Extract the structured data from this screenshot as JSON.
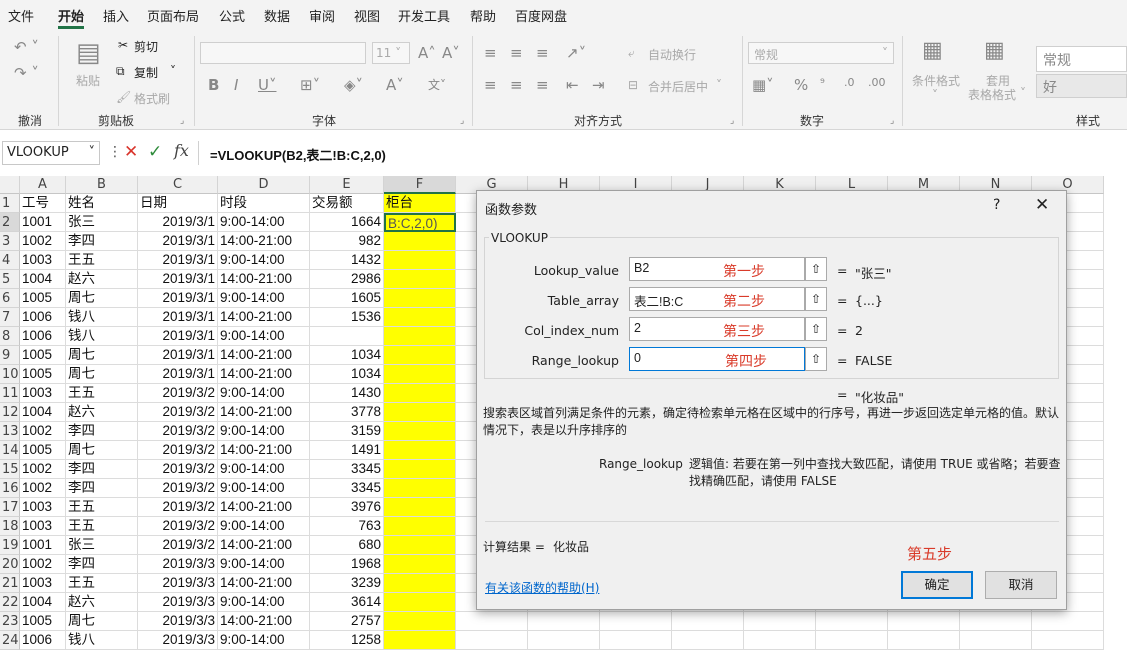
{
  "menu": {
    "tabs": [
      "文件",
      "开始",
      "插入",
      "页面布局",
      "公式",
      "数据",
      "审阅",
      "视图",
      "开发工具",
      "帮助",
      "百度网盘"
    ]
  },
  "ribbon": {
    "undo_group": "撤消",
    "clipboard": {
      "cut": "剪切",
      "copy": "复制",
      "paste": "粘贴",
      "painter": "格式刷",
      "label": "剪贴板"
    },
    "font": {
      "size": "11",
      "label": "字体"
    },
    "alignment": {
      "wrap": "自动换行",
      "merge": "合并后居中",
      "label": "对齐方式"
    },
    "number": {
      "format": "常规",
      "label": "数字"
    },
    "styles": {
      "conditional": "条件格式",
      "table_fmt_1": "套用",
      "table_fmt_2": "表格格式",
      "style_normal": "常规",
      "style_good": "好",
      "label": "样式"
    }
  },
  "formula_bar": {
    "name_box": "VLOOKUP",
    "formula": "=VLOOKUP(B2,表二!B:C,2,0)"
  },
  "sheet": {
    "columns": [
      "A",
      "B",
      "C",
      "D",
      "E",
      "F",
      "G",
      "H",
      "I",
      "J",
      "K",
      "L",
      "M",
      "N",
      "O"
    ],
    "header_row": [
      "工号",
      "姓名",
      "日期",
      "时段",
      "交易额",
      "柜台"
    ],
    "rows": [
      [
        "1001",
        "张三",
        "2019/3/1",
        "9:00-14:00",
        "1664",
        "B:C,2,0)"
      ],
      [
        "1002",
        "李四",
        "2019/3/1",
        "14:00-21:00",
        "982",
        ""
      ],
      [
        "1003",
        "王五",
        "2019/3/1",
        "9:00-14:00",
        "1432",
        ""
      ],
      [
        "1004",
        "赵六",
        "2019/3/1",
        "14:00-21:00",
        "2986",
        ""
      ],
      [
        "1005",
        "周七",
        "2019/3/1",
        "9:00-14:00",
        "1605",
        ""
      ],
      [
        "1006",
        "钱八",
        "2019/3/1",
        "14:00-21:00",
        "1536",
        ""
      ],
      [
        "1006",
        "钱八",
        "2019/3/1",
        "9:00-14:00",
        "",
        ""
      ],
      [
        "1005",
        "周七",
        "2019/3/1",
        "14:00-21:00",
        "1034",
        ""
      ],
      [
        "1005",
        "周七",
        "2019/3/1",
        "14:00-21:00",
        "1034",
        ""
      ],
      [
        "1003",
        "王五",
        "2019/3/2",
        "9:00-14:00",
        "1430",
        ""
      ],
      [
        "1004",
        "赵六",
        "2019/3/2",
        "14:00-21:00",
        "3778",
        ""
      ],
      [
        "1002",
        "李四",
        "2019/3/2",
        "9:00-14:00",
        "3159",
        ""
      ],
      [
        "1005",
        "周七",
        "2019/3/2",
        "14:00-21:00",
        "1491",
        ""
      ],
      [
        "1002",
        "李四",
        "2019/3/2",
        "9:00-14:00",
        "3345",
        ""
      ],
      [
        "1002",
        "李四",
        "2019/3/2",
        "9:00-14:00",
        "3345",
        ""
      ],
      [
        "1003",
        "王五",
        "2019/3/2",
        "14:00-21:00",
        "3976",
        ""
      ],
      [
        "1003",
        "王五",
        "2019/3/2",
        "9:00-14:00",
        "763",
        ""
      ],
      [
        "1001",
        "张三",
        "2019/3/2",
        "14:00-21:00",
        "680",
        ""
      ],
      [
        "1002",
        "李四",
        "2019/3/3",
        "9:00-14:00",
        "1968",
        ""
      ],
      [
        "1003",
        "王五",
        "2019/3/3",
        "14:00-21:00",
        "3239",
        ""
      ],
      [
        "1004",
        "赵六",
        "2019/3/3",
        "9:00-14:00",
        "3614",
        ""
      ],
      [
        "1005",
        "周七",
        "2019/3/3",
        "14:00-21:00",
        "2757",
        ""
      ],
      [
        "1006",
        "钱八",
        "2019/3/3",
        "9:00-14:00",
        "1258",
        ""
      ]
    ]
  },
  "dialog": {
    "title": "函数参数",
    "help_glyph": "?",
    "close_glyph": "✕",
    "function_name": "VLOOKUP",
    "args": [
      {
        "label": "Lookup_value",
        "value": "B2",
        "step": "第一步",
        "result": "\"张三\""
      },
      {
        "label": "Table_array",
        "value": "表二!B:C",
        "step": "第二步",
        "result": "{...}"
      },
      {
        "label": "Col_index_num",
        "value": "2",
        "step": "第三步",
        "result": "2"
      },
      {
        "label": "Range_lookup",
        "value": "0",
        "step": "第四步",
        "result": "FALSE"
      }
    ],
    "overall_result": "\"化妆品\"",
    "description": "搜索表区域首列满足条件的元素，确定待检索单元格在区域中的行序号，再进一步返回选定单元格的值。默认情况下，表是以升序排序的",
    "param_name": "Range_lookup",
    "param_desc": "逻辑值: 若要在第一列中查找大致匹配，请使用 TRUE 或省略；若要查找精确匹配，请使用 FALSE",
    "calc_label": "计算结果 =",
    "calc_value": "化妆品",
    "step5": "第五步",
    "help_link": "有关该函数的帮助(H)",
    "ok": "确定",
    "cancel": "取消"
  }
}
